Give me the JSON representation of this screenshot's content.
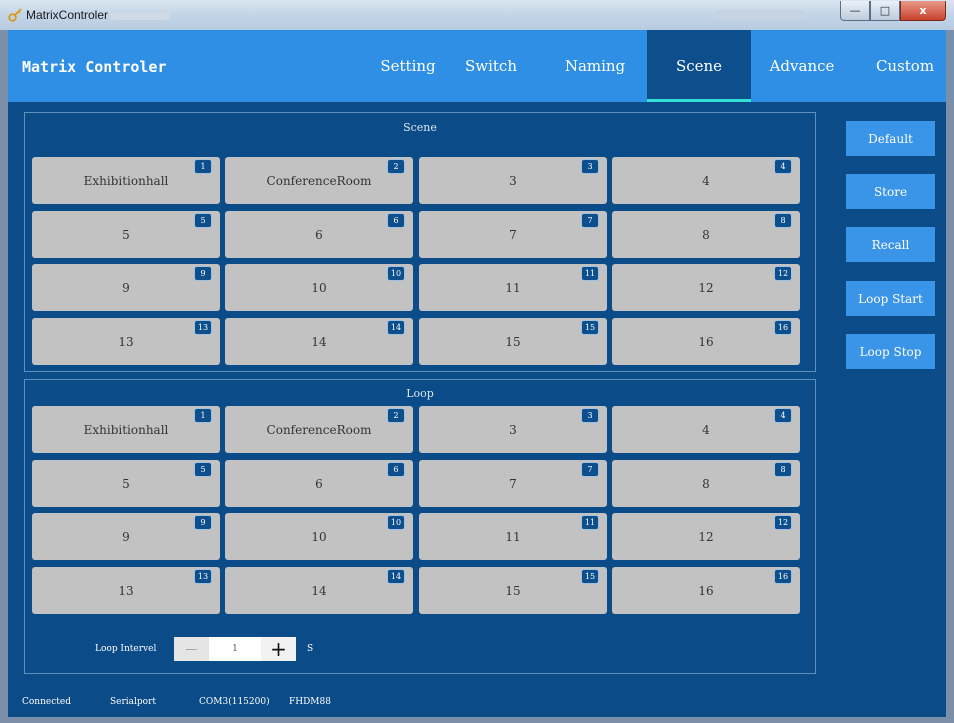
{
  "window": {
    "title": "MatrixControler",
    "min": "—",
    "max": "□",
    "close": "x"
  },
  "header": {
    "title": "Matrix Controler"
  },
  "tabs": [
    {
      "label": "Setting"
    },
    {
      "label": "Switch"
    },
    {
      "label": "Naming"
    },
    {
      "label": "Scene",
      "active": true
    },
    {
      "label": "Advance"
    },
    {
      "label": "Custom"
    }
  ],
  "scene": {
    "title": "Scene",
    "cells": [
      {
        "label": "Exhibitionhall",
        "num": "1"
      },
      {
        "label": "ConferenceRoom",
        "num": "2"
      },
      {
        "label": "3",
        "num": "3"
      },
      {
        "label": "4",
        "num": "4"
      },
      {
        "label": "5",
        "num": "5"
      },
      {
        "label": "6",
        "num": "6"
      },
      {
        "label": "7",
        "num": "7"
      },
      {
        "label": "8",
        "num": "8"
      },
      {
        "label": "9",
        "num": "9"
      },
      {
        "label": "10",
        "num": "10"
      },
      {
        "label": "11",
        "num": "11"
      },
      {
        "label": "12",
        "num": "12"
      },
      {
        "label": "13",
        "num": "13"
      },
      {
        "label": "14",
        "num": "14"
      },
      {
        "label": "15",
        "num": "15"
      },
      {
        "label": "16",
        "num": "16"
      }
    ]
  },
  "loop": {
    "title": "Loop",
    "cells": [
      {
        "label": "Exhibitionhall",
        "num": "1"
      },
      {
        "label": "ConferenceRoom",
        "num": "2"
      },
      {
        "label": "3",
        "num": "3"
      },
      {
        "label": "4",
        "num": "4"
      },
      {
        "label": "5",
        "num": "5"
      },
      {
        "label": "6",
        "num": "6"
      },
      {
        "label": "7",
        "num": "7"
      },
      {
        "label": "8",
        "num": "8"
      },
      {
        "label": "9",
        "num": "9"
      },
      {
        "label": "10",
        "num": "10"
      },
      {
        "label": "11",
        "num": "11"
      },
      {
        "label": "12",
        "num": "12"
      },
      {
        "label": "13",
        "num": "13"
      },
      {
        "label": "14",
        "num": "14"
      },
      {
        "label": "15",
        "num": "15"
      },
      {
        "label": "16",
        "num": "16"
      }
    ],
    "interval_label": "Loop Intervel",
    "interval_value": "1",
    "interval_unit": "S",
    "minus": "—",
    "plus": "+"
  },
  "buttons": {
    "default": "Default",
    "store": "Store",
    "recall": "Recall",
    "loop_start": "Loop Start",
    "loop_stop": "Loop Stop"
  },
  "status": {
    "connection": "Connected",
    "port_type": "Serialport",
    "port": "COM3(115200)",
    "model": "FHDM88"
  },
  "colors": {
    "background": "#0b4b87",
    "header": "#2f8fe4",
    "active_tab": "#0d4f8d",
    "tab_indicator": "#33e0d6",
    "cell": "#c2c2c2",
    "side_button": "#3a95e8"
  }
}
